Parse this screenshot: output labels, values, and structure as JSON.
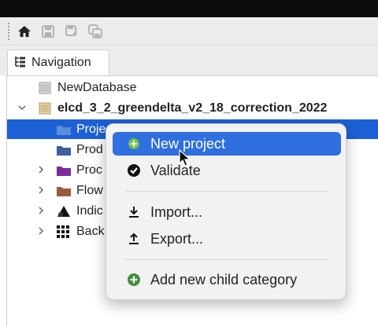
{
  "toolbar": {
    "buttons": [
      {
        "icon": "home-icon"
      },
      {
        "icon": "save-icon"
      },
      {
        "icon": "save-as-icon"
      },
      {
        "icon": "save-all-icon"
      }
    ]
  },
  "navigation": {
    "tab_label": "Navigation"
  },
  "tree": {
    "items": [
      {
        "label": "NewDatabase"
      },
      {
        "label": "elcd_3_2_greendelta_v2_18_correction_2022"
      },
      {
        "label": "Proje"
      },
      {
        "label": "Prod"
      },
      {
        "label": "Proc"
      },
      {
        "label": "Flow"
      },
      {
        "label": "Indic"
      },
      {
        "label": "Back"
      }
    ]
  },
  "context_menu": {
    "items": [
      {
        "label": "New project",
        "icon": "add-circle-icon"
      },
      {
        "label": "Validate",
        "icon": "check-circle-icon"
      },
      {
        "label": "Import...",
        "icon": "import-icon"
      },
      {
        "label": "Export...",
        "icon": "export-icon"
      },
      {
        "label": "Add new child category",
        "icon": "add-circle-green-icon"
      }
    ]
  },
  "colors": {
    "selection": "#1d5fd6",
    "menu_highlight": "#2f6fe0",
    "folder_blue": "#3d6fb5",
    "folder_purple": "#7a2c9a",
    "folder_brown": "#9a5a3c",
    "accent_green": "#3f8f3a"
  }
}
